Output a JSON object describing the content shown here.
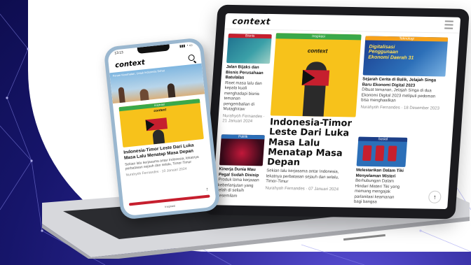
{
  "colors": {
    "accent_green": "#3aa84a",
    "accent_red": "#c61f2e",
    "accent_blue": "#2c6fb8",
    "feature_yellow": "#f7c21b"
  },
  "site": {
    "logo": "context",
    "menu_icon": "hamburger-menu-icon",
    "scroll_top": "↑"
  },
  "laptop": {
    "featured": {
      "category": "Inspirasi",
      "thumb_logo": "context",
      "headline": "Indonesia-Timor Leste Dari Luka Masa Lalu Menatap Masa Depan",
      "summary": "Sekian lalu kerjasama antar Indonesia, lekatnya perbatasan sejauh dan selalu, Timor-Timur",
      "byline": "Nurahyoh Fernandes · 07 Januari 2024"
    },
    "left_top": {
      "category": "Bisnis",
      "headline": "Jalan Bijaks dan Bisnis Perusahaan Batulalas",
      "summary": "Riset masa lalu dan kepala kuali menghadapi bisnis temanan pengembalian di Mutaghiraw",
      "byline": "Nurahyoh Fernandes · 21 Januari 2024"
    },
    "left_bottom": {
      "category": "Politik",
      "headline": "Kinerja Dunia Mau Pegal Sudah Disisip",
      "summary": "Produk lama kerjaaan keberlanjutan yang telah di selisih kesemilam",
      "byline": ""
    },
    "right_top": {
      "category": "Teknologi",
      "headline": "Sejarah Cerita di Balik, Jelajah Singa Baru Ekonomi Digital 2023",
      "summary": "Dibuat temanan, Jelajah Singa di dua Ekonomi Digital 2023 meliputi pedoman bisa menghasilkan",
      "byline": "Nurahyoh Fernandes · 18 Desember 2023",
      "thumb_text": "Digitalisasi Penggunaan Ekonomi Daerah 31"
    },
    "right_bottom": {
      "category": "Sosial",
      "headline": "Melestarikan Dalam Tiki Menyelaman Misteri",
      "summary": "Berhubungan Dalam Hindari Misteri Tiki yang memang mengajak parlanitasi keamanan bagi bangsa",
      "byline": ""
    }
  },
  "phone": {
    "time": "13:13",
    "signal": "▮▮▮ ◔ ▭",
    "logo": "context",
    "search_icon": "search-icon",
    "banner_text": "Forum Kesehatan, Untuk Indonesia Sehat",
    "featured": {
      "category": "Inspirasi",
      "thumb_logo": "context",
      "headline": "Indonesia-Timor Leste Dari Luka Masa Lalu Menatap Masa Depan",
      "summary": "Sekian lalu kerjasama antar Indonesia, lekatnya perbatasan sejauh dan selalu, Timor-Timur",
      "byline": "Nurahyoh Fernandes · 10 Januari 2024"
    },
    "scroll_top": "↑",
    "bottom_label": "Inspirasi"
  }
}
